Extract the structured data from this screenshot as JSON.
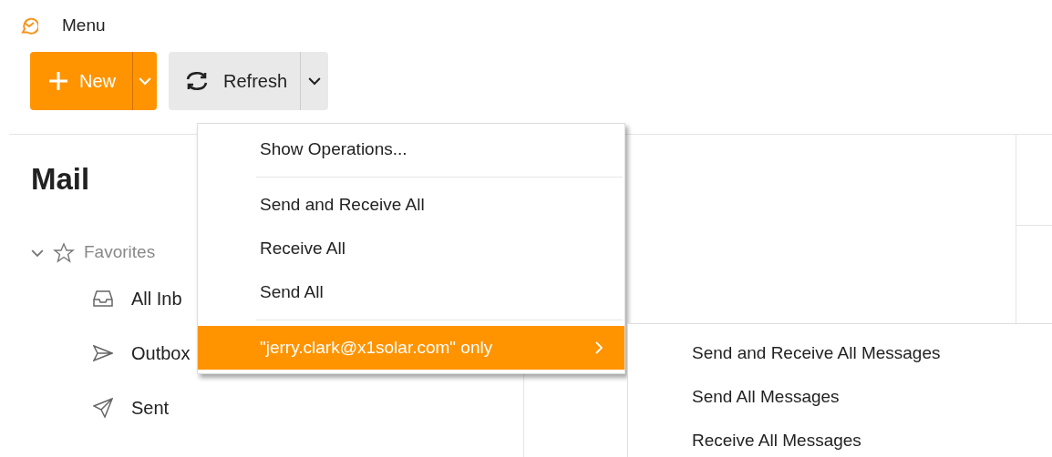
{
  "header": {
    "menu_label": "Menu"
  },
  "toolbar": {
    "new_button": {
      "label": "New"
    },
    "refresh_button": {
      "label": "Refresh"
    }
  },
  "sidebar": {
    "title": "Mail",
    "tree": [
      {
        "label": "Favorites",
        "expanded": true,
        "children": [
          {
            "label": "All Inb",
            "kind": "inbox"
          },
          {
            "label": "Outbox",
            "kind": "outbox"
          },
          {
            "label": "Sent",
            "kind": "sent"
          }
        ]
      }
    ]
  },
  "refresh_menu": {
    "items": [
      {
        "kind": "item",
        "label": "Show Operations...",
        "selected": false
      },
      {
        "kind": "separator"
      },
      {
        "kind": "item",
        "label": "Send and Receive All",
        "selected": false
      },
      {
        "kind": "item",
        "label": "Receive All",
        "selected": false
      },
      {
        "kind": "item",
        "label": "Send All",
        "selected": false
      },
      {
        "kind": "separator"
      },
      {
        "kind": "submenu",
        "label": "\"jerry.clark@x1solar.com\" only",
        "selected": true
      }
    ]
  },
  "submenu": {
    "items": [
      {
        "label": "Send and Receive All Messages"
      },
      {
        "label": "Send All Messages"
      },
      {
        "label": "Receive All Messages"
      }
    ]
  }
}
